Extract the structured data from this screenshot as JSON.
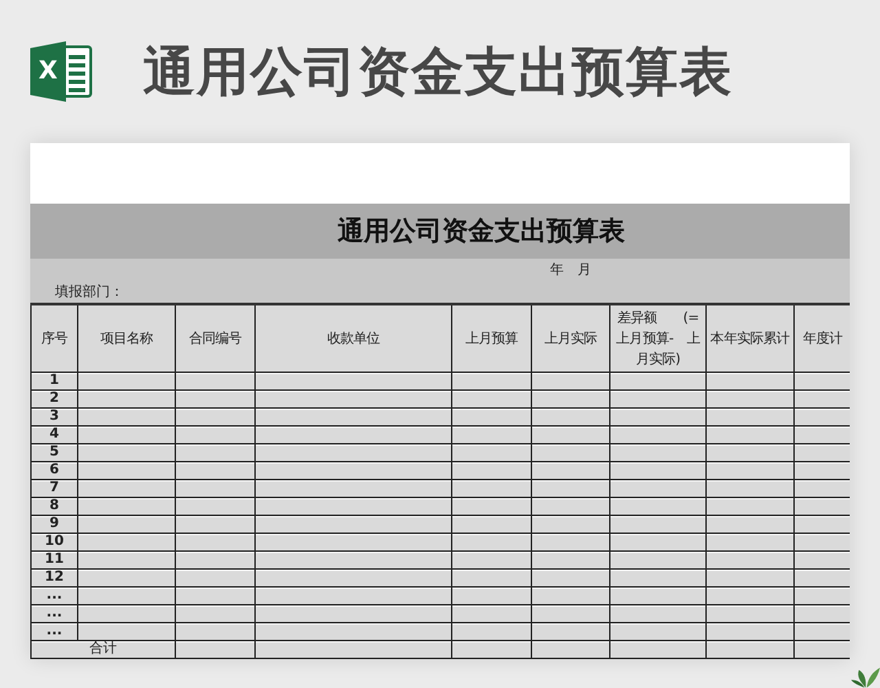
{
  "app_icon": {
    "letter": "X"
  },
  "heading": "通用公司资金支出预算表",
  "sheet": {
    "title": "通用公司资金支出预算表",
    "period": "年　月",
    "department_label": "填报部门：",
    "columns": [
      "序号",
      "项目名称",
      "合同编号",
      "收款单位",
      "上月预算",
      "上月实际",
      "差异额　　(=上月预算-　上月实际)",
      "本年实际累计",
      "年度计"
    ],
    "rows": [
      {
        "no": "1"
      },
      {
        "no": "2"
      },
      {
        "no": "3"
      },
      {
        "no": "4"
      },
      {
        "no": "5"
      },
      {
        "no": "6"
      },
      {
        "no": "7"
      },
      {
        "no": "8"
      },
      {
        "no": "9"
      },
      {
        "no": "10"
      },
      {
        "no": "11"
      },
      {
        "no": "12"
      },
      {
        "no": "..."
      },
      {
        "no": "..."
      },
      {
        "no": "..."
      }
    ],
    "total_label": "合计"
  }
}
